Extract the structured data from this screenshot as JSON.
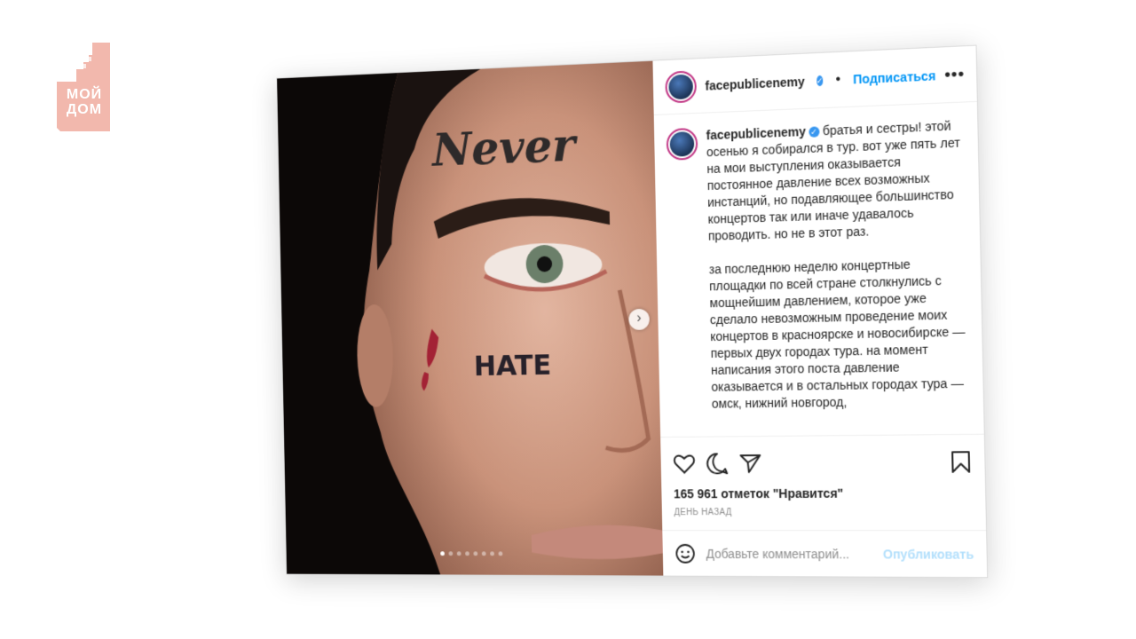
{
  "brand": {
    "logo_line1": "МОЙ",
    "logo_line2": "ДОМ",
    "logo_color": "#f2b8ad"
  },
  "post": {
    "username": "facepublicenemy",
    "follow_label": "Подписаться",
    "more_label": "•••",
    "caption_paragraphs": [
      "братья и сестры! этой осенью я собирался в тур. вот уже пять лет на мои выступления оказывается постоянное давление всех возможных инстанций, но подавляющее большинство концертов так или иначе удавалось проводить. но не в этот раз.",
      "за последнюю неделю концертные площадки по всей стране столкнулись с мощнейшим давлением, которое уже сделало невозможным проведение моих концертов в красноярске и новосибирске — первых двух городах тура. на момент написания этого поста давление оказывается и в остальных городах тура — омск, нижний новгород,"
    ],
    "likes": "165 961 отметок \"Нравится\"",
    "time_ago": "ДЕНЬ НАЗАД",
    "comment_placeholder": "Добавьте комментарий...",
    "publish_label": "Опубликовать",
    "carousel_count": 8,
    "carousel_active": 1
  },
  "photo": {
    "forehead_tattoo": "Never",
    "cheek_tattoo": "HATE"
  },
  "colors": {
    "link_blue": "#0095f6",
    "publish_disabled": "#b2dffc",
    "verified_blue": "#3897f0",
    "story_ring": "#c13584"
  }
}
